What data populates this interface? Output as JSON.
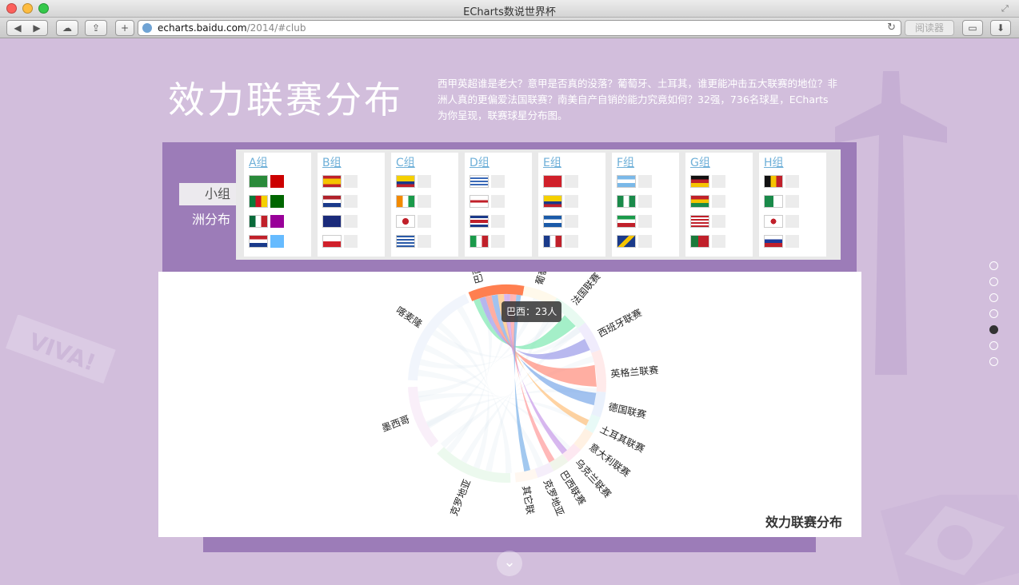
{
  "window": {
    "title": "ECharts数说世界杯"
  },
  "toolbar": {
    "url_host": "echarts.baidu.com",
    "url_path": "/2014/#club",
    "reader_label": "阅读器"
  },
  "page": {
    "title": "效力联赛分布",
    "description": "西甲英超谁是老大？意甲是否真的没落？葡萄牙、土耳其，谁更能冲击五大联赛的地位？非洲人真的更偏爱法国联赛？南美自产自销的能力究竟如何？32强，736名球星，ECharts为你呈现，联赛球星分布图。",
    "tabs": [
      "小组",
      "洲分布"
    ],
    "groups": [
      {
        "label": "A组",
        "teams": [
          "brazil-flag",
          "cameroon-flag",
          "mexico-flag",
          "croatia-flag"
        ]
      },
      {
        "label": "B组",
        "teams": [
          "spain-flag",
          "netherlands-flag",
          "australia-flag",
          "chile-flag"
        ]
      },
      {
        "label": "C组",
        "teams": [
          "colombia-flag",
          "ivory-coast-flag",
          "japan-flag",
          "greece-flag"
        ]
      },
      {
        "label": "D组",
        "teams": [
          "uruguay-flag",
          "england-flag",
          "costa-rica-flag",
          "italy-flag"
        ]
      },
      {
        "label": "E组",
        "teams": [
          "switzerland-flag",
          "ecuador-flag",
          "honduras-flag",
          "france-flag"
        ]
      },
      {
        "label": "F组",
        "teams": [
          "argentina-flag",
          "nigeria-flag",
          "iran-flag",
          "bosnia-flag"
        ]
      },
      {
        "label": "G组",
        "teams": [
          "germany-flag",
          "ghana-flag",
          "usa-flag",
          "portugal-flag"
        ]
      },
      {
        "label": "H组",
        "teams": [
          "belgium-flag",
          "algeria-flag",
          "korea-flag",
          "russia-flag"
        ]
      }
    ],
    "group_a_swatches": [
      "#cc0000",
      "#006600",
      "#990099",
      "#66bbff"
    ],
    "tooltip": "巴西：23人",
    "chart_title": "效力联赛分布"
  },
  "chart_data": {
    "type": "chord",
    "title": "效力联赛分布",
    "nodes": [
      "巴西",
      "葡萄牙联赛",
      "法国联赛",
      "西班牙联赛",
      "英格兰联赛",
      "德国联赛",
      "土耳其联赛",
      "意大利联赛",
      "乌克兰联赛",
      "巴西联赛",
      "克罗地亚",
      "其它联赛",
      "克罗地亚",
      "墨西哥",
      "喀麦隆"
    ],
    "highlight": "巴西",
    "tooltip": {
      "node": "巴西",
      "value": 23,
      "unit": "人"
    }
  },
  "colors": {
    "page_bg": "#d2bedc",
    "panel": "#9c7cb8",
    "link": "#6fb0d8"
  }
}
